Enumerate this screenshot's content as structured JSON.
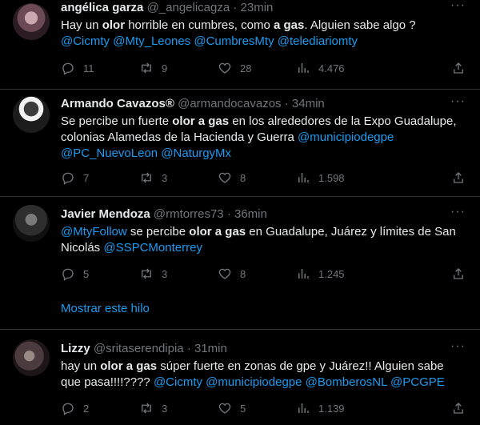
{
  "tweets": [
    {
      "name": "angélica garza",
      "handle": "@_angelicagza",
      "sep": "·",
      "time": "23min",
      "text_1": "Hay un ",
      "text_2": "olor",
      "text_3": " horrible en cumbres, como ",
      "text_4": "a gas",
      "text_5": ".  Alguien sabe algo ?",
      "mentions": [
        "@Cicmty",
        "@Mty_Leones",
        "@CumbresMty",
        "@telediariomty"
      ],
      "replies": "11",
      "retweets": "9",
      "likes": "28",
      "views": "4.476"
    },
    {
      "name": "Armando Cavazos®",
      "handle": "@armandocavazos",
      "sep": "·",
      "time": "34min",
      "text_1": "Se percibe un fuerte ",
      "text_2": "olor a gas",
      "text_3": " en los alrededores de la Expo Guadalupe,",
      "text_4": "colonias Alamedas de la Hacienda y Guerra ",
      "mentions": [
        "@municipiodegpe",
        "@PC_NuevoLeon",
        "@NaturgyMx"
      ],
      "replies": "7",
      "retweets": "3",
      "likes": "8",
      "views": "1.598"
    },
    {
      "name": "Javier Mendoza",
      "handle": "@rmtorres73",
      "sep": "·",
      "time": "36min",
      "mention_1": "@MtyFollow",
      "text_1": " se percibe ",
      "text_2": "olor a gas",
      "text_3": " en Guadalupe, Juárez y límites de San",
      "text_4": "Nicolás ",
      "mention_2": "@SSPCMonterrey",
      "replies": "5",
      "retweets": "3",
      "likes": "8",
      "views": "1.245",
      "show_thread": "Mostrar este hilo"
    },
    {
      "name": "Lizzy",
      "handle": "@sritaserendipia",
      "sep": "·",
      "time": "31min",
      "text_1": "hay un ",
      "text_2": "olor a gas",
      "text_3": " súper fuerte en zonas de gpe y Juárez!! Alguien sabe",
      "text_4": "que pasa!!!!???? ",
      "mentions": [
        "@Cicmty",
        "@municipiodegpe",
        "@BomberosNL",
        "@PCGPE"
      ],
      "replies": "2",
      "retweets": "3",
      "likes": "5",
      "views": "1.139"
    }
  ],
  "more_label": "···",
  "colors": {
    "background": "#000000",
    "text": "#e7e9ea",
    "muted": "#71767b",
    "link": "#1d9bf0",
    "divider": "#2f3336"
  }
}
